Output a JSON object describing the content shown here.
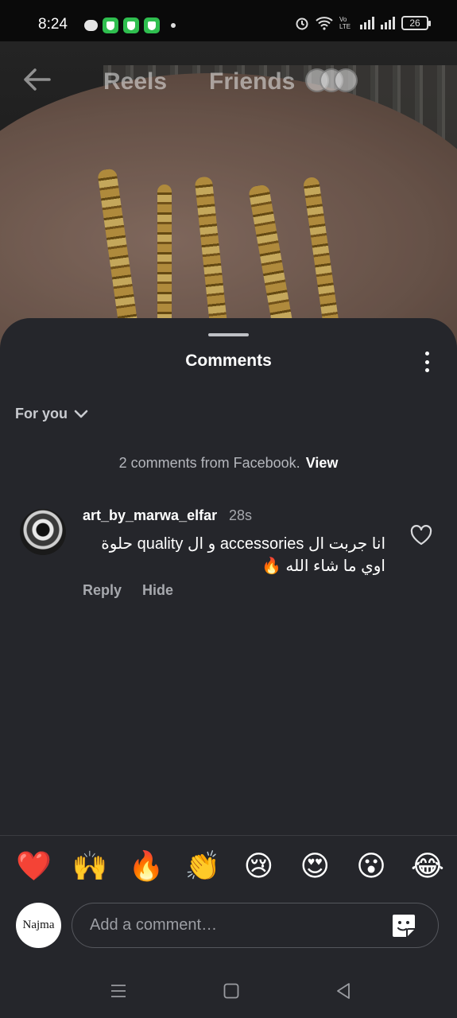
{
  "status_bar": {
    "time": "8:24",
    "volte": "Vo LTE",
    "battery": "26"
  },
  "reel_header": {
    "tab_reels": "Reels",
    "tab_friends": "Friends"
  },
  "comments_sheet": {
    "title": "Comments",
    "sort_label": "For you",
    "facebook_notice": "2 comments from Facebook.",
    "facebook_view": "View",
    "comments": [
      {
        "username": "art_by_marwa_elfar",
        "time": "28s",
        "text": "انا جربت ال accessories و ال quality حلوة اوي ما شاء الله 🔥",
        "reply_label": "Reply",
        "hide_label": "Hide"
      }
    ]
  },
  "emoji_reactions": [
    "❤️",
    "🙌",
    "🔥",
    "👏",
    "😢",
    "😍",
    "😮",
    "😂"
  ],
  "composer": {
    "avatar_text": "Najma",
    "placeholder": "Add a comment…"
  },
  "colors": {
    "sheet_bg": "#25262b",
    "secondary_text": "#a7a9ae"
  }
}
